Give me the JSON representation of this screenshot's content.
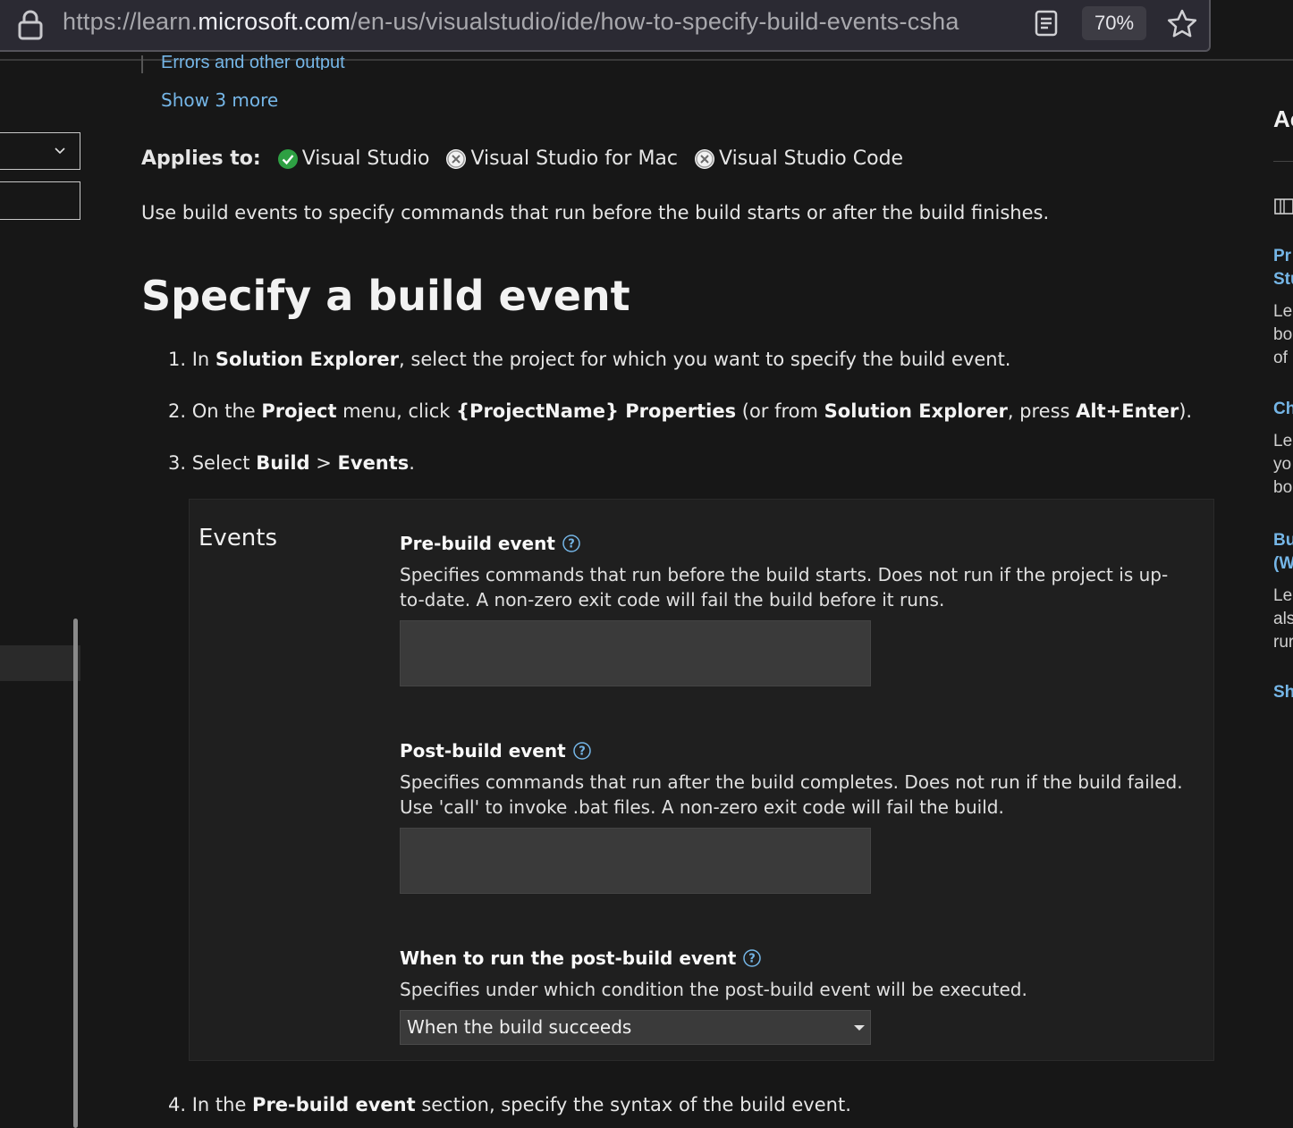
{
  "browser": {
    "url_prefix": "https://learn.",
    "url_domain": "microsoft.com",
    "url_path": "/en-us/visualstudio/ide/how-to-specify-build-events-csha",
    "zoom": "70%",
    "icons": [
      "lock-icon",
      "reader-view-icon",
      "bookmark-star-icon"
    ]
  },
  "toc": {
    "cut_item": "Errors and other output",
    "show_more": "Show 3 more"
  },
  "applies": {
    "label": "Applies to:",
    "items": [
      {
        "name": "Visual Studio",
        "status": "yes",
        "color": "#2ea043"
      },
      {
        "name": "Visual Studio for Mac",
        "status": "no"
      },
      {
        "name": "Visual Studio Code",
        "status": "no"
      }
    ]
  },
  "intro": "Use build events to specify commands that run before the build starts or after the build finishes.",
  "heading": "Specify a build event",
  "steps": {
    "s1": {
      "num": "1.",
      "a": " In ",
      "b1": "Solution Explorer",
      "c": ", select the project for which you want to specify the build event."
    },
    "s2": {
      "num": "2.",
      "a": " On the ",
      "b1": "Project",
      "c": " menu, click ",
      "b2": "{ProjectName} Properties",
      "d": " (or from ",
      "b3": "Solution Explorer",
      "e": ", press ",
      "b4": "Alt+Enter",
      "f": ")."
    },
    "s3": {
      "num": "3.",
      "a": " Select ",
      "b1": "Build",
      "c": " > ",
      "b2": "Events",
      "d": "."
    },
    "s4": {
      "num": "4.",
      "a": " In the ",
      "b1": "Pre-build event",
      "c": " section, specify the syntax of the build event."
    }
  },
  "events_panel": {
    "title": "Events",
    "prebuild": {
      "label": "Pre-build event",
      "desc": "Specifies commands that run before the build starts. Does not run if the project is up-to-date. A non-zero exit code will fail the build before it runs.",
      "value": ""
    },
    "postbuild": {
      "label": "Post-build event",
      "desc": "Specifies commands that run after the build completes. Does not run if the build failed. Use 'call' to invoke .bat files. A non-zero exit code will fail the build.",
      "value": ""
    },
    "when": {
      "label": "When to run the post-build event",
      "desc": "Specifies under which condition the post-build event will be executed.",
      "selected": "When the build succeeds"
    }
  },
  "rail": {
    "heading": "Ac",
    "items": [
      {
        "l1": "Pr",
        "l2": "Stu",
        "t1": "Lea",
        "t2": "bo",
        "t3": "of"
      },
      {
        "l1": "Ch",
        "t1": "Lea",
        "t2": "yo",
        "t3": "bo"
      },
      {
        "l1": "Bu",
        "l2": "(W",
        "t1": "Lea",
        "t2": "als",
        "t3": "rur"
      }
    ],
    "show": "Sh"
  },
  "colors": {
    "accent_link": "#75b6e7",
    "check_green": "#2ea043"
  }
}
